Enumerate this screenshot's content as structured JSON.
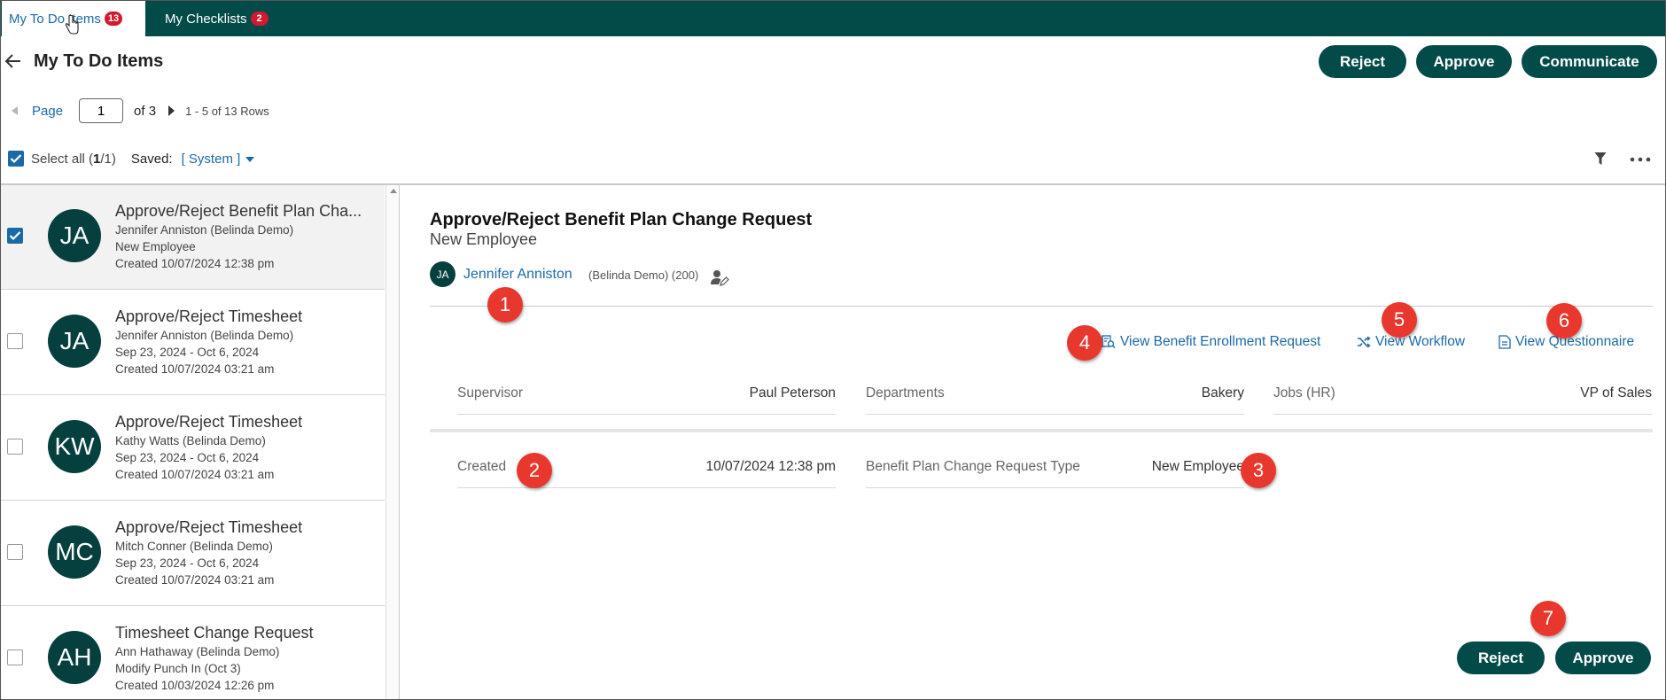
{
  "tabs": [
    {
      "label": "My To Do Items",
      "count": "13"
    },
    {
      "label": "My Checklists",
      "count": "2"
    }
  ],
  "header": {
    "title": "My To Do Items",
    "reject_label": "Reject",
    "approve_label": "Approve",
    "communicate_label": "Communicate"
  },
  "pagination": {
    "page_label": "Page",
    "page_value": "1",
    "of_label": "of 3",
    "rows_label": "1 - 5 of 13 Rows"
  },
  "selection": {
    "select_all_label": "Select all (",
    "selected": "1",
    "total_suffix": "/1)",
    "saved_label": "Saved:",
    "saved_value": "[ System ]"
  },
  "list": [
    {
      "initials": "JA",
      "title": "Approve/Reject Benefit Plan Cha...",
      "line1": "Jennifer Anniston (Belinda Demo)",
      "line2": "New Employee",
      "line3": "Created 10/07/2024 12:38 pm",
      "checked": true
    },
    {
      "initials": "JA",
      "title": "Approve/Reject Timesheet",
      "line1": "Jennifer Anniston (Belinda Demo)",
      "line2": "Sep 23, 2024 - Oct 6, 2024",
      "line3": "Created 10/07/2024 03:21 am",
      "checked": false
    },
    {
      "initials": "KW",
      "title": "Approve/Reject Timesheet",
      "line1": "Kathy Watts (Belinda Demo)",
      "line2": "Sep 23, 2024 - Oct 6, 2024",
      "line3": "Created 10/07/2024 03:21 am",
      "checked": false
    },
    {
      "initials": "MC",
      "title": "Approve/Reject Timesheet",
      "line1": "Mitch Conner (Belinda Demo)",
      "line2": "Sep 23, 2024 - Oct 6, 2024",
      "line3": "Created 10/07/2024 03:21 am",
      "checked": false
    },
    {
      "initials": "AH",
      "title": "Timesheet Change Request",
      "line1": "Ann Hathaway (Belinda Demo)",
      "line2": "Modify Punch In (Oct 3)",
      "line3": "Created 10/03/2024 12:26 pm",
      "checked": false
    }
  ],
  "detail": {
    "title": "Approve/Reject Benefit Plan Change Request",
    "subtitle": "New Employee",
    "avatar_initials": "JA",
    "employee_name": "Jennifer Anniston",
    "employee_meta": "(Belinda Demo) (200)",
    "links": {
      "enrollment": "View Benefit Enrollment Request",
      "workflow": "View Workflow",
      "questionnaire": "View Questionnaire"
    },
    "fields": {
      "supervisor_label": "Supervisor",
      "supervisor_value": "Paul Peterson",
      "departments_label": "Departments",
      "departments_value": "Bakery",
      "jobs_label": "Jobs (HR)",
      "jobs_value": "VP of Sales",
      "created_label": "Created",
      "created_value": "10/07/2024 12:38 pm",
      "type_label": "Benefit Plan Change Request Type",
      "type_value": "New Employee"
    },
    "reject_label": "Reject",
    "approve_label": "Approve"
  },
  "markers": [
    "1",
    "2",
    "3",
    "4",
    "5",
    "6",
    "7"
  ],
  "colors": {
    "brand_dark_teal": "#024b49",
    "avatar_teal": "#06403e",
    "link_blue": "#1a6aa8",
    "badge_red": "#d2192f",
    "marker_red": "#e8382e"
  },
  "icons": [
    "cursor-icon",
    "back-arrow-icon",
    "filter-icon",
    "more-icon",
    "user-edit-icon",
    "document-search-icon",
    "shuffle-icon",
    "document-icon",
    "checkmark-icon",
    "caret-down-icon"
  ]
}
